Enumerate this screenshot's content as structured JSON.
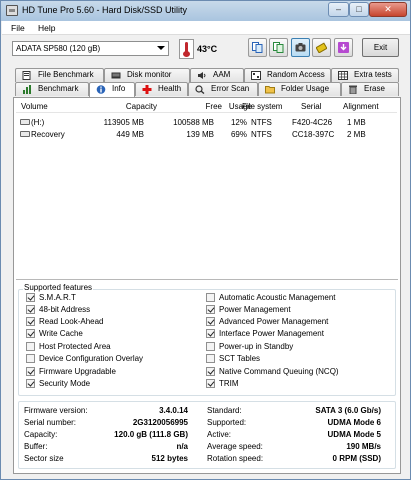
{
  "window": {
    "title": "HD Tune Pro 5.60 - Hard Disk/SSD Utility",
    "minimize": "–",
    "maximize": "□",
    "close": "✕"
  },
  "menu": [
    "File",
    "Help"
  ],
  "toolbar": {
    "drive": "ADATA SP580 (120 gB)",
    "temperature": "43°C",
    "exit_label": "Exit",
    "buttons": [
      "copy-icon",
      "copy-all-icon",
      "camera-icon",
      "options-icon",
      "download-icon"
    ]
  },
  "tabs_top": [
    "File Benchmark",
    "Disk monitor",
    "AAM",
    "Random Access",
    "Extra tests"
  ],
  "tabs_bottom": [
    "Benchmark",
    "Info",
    "Health",
    "Error Scan",
    "Folder Usage",
    "Erase"
  ],
  "active_tab": "Info",
  "volumes": {
    "headers": [
      "Volume",
      "Capacity",
      "Free",
      "Usage",
      "File system",
      "Serial",
      "Alignment"
    ],
    "rows": [
      {
        "volume": "(H:)",
        "capacity": "113905 MB",
        "free": "100588 MB",
        "usage": "12%",
        "fs": "NTFS",
        "serial": "F420-4C26",
        "alignment": "1 MB"
      },
      {
        "volume": "Recovery",
        "capacity": "449 MB",
        "free": "139 MB",
        "usage": "69%",
        "fs": "NTFS",
        "serial": "CC18-397C",
        "alignment": "2 MB"
      }
    ]
  },
  "features": {
    "legend": "Supported features",
    "left": [
      {
        "label": "S.M.A.R.T",
        "checked": true
      },
      {
        "label": "48-bit Address",
        "checked": true
      },
      {
        "label": "Read Look-Ahead",
        "checked": true
      },
      {
        "label": "Write Cache",
        "checked": true
      },
      {
        "label": "Host Protected Area",
        "checked": false
      },
      {
        "label": "Device Configuration Overlay",
        "checked": false
      },
      {
        "label": "Firmware Upgradable",
        "checked": true
      },
      {
        "label": "Security Mode",
        "checked": true
      }
    ],
    "right": [
      {
        "label": "Automatic Acoustic Management",
        "checked": false
      },
      {
        "label": "Power Management",
        "checked": true
      },
      {
        "label": "Advanced Power Management",
        "checked": true
      },
      {
        "label": "Interface Power Management",
        "checked": true
      },
      {
        "label": "Power-up in Standby",
        "checked": false
      },
      {
        "label": "SCT Tables",
        "checked": false
      },
      {
        "label": "Native Command Queuing (NCQ)",
        "checked": true
      },
      {
        "label": "TRIM",
        "checked": true
      }
    ]
  },
  "info": {
    "left": [
      {
        "label": "Firmware version:",
        "value": "3.4.0.14"
      },
      {
        "label": "Serial number:",
        "value": "2G3120056995"
      },
      {
        "label": "Capacity:",
        "value": "120.0 gB (111.8 GB)"
      },
      {
        "label": "Buffer:",
        "value": "n/a"
      },
      {
        "label": "Sector size",
        "value": "512 bytes"
      }
    ],
    "right": [
      {
        "label": "Standard:",
        "value": "SATA 3 (6.0 Gb/s)"
      },
      {
        "label": "Supported:",
        "value": "UDMA Mode 6"
      },
      {
        "label": "Active:",
        "value": "UDMA Mode 5"
      },
      {
        "label": "Average speed:",
        "value": "190 MB/s"
      },
      {
        "label": "Rotation speed:",
        "value": "0 RPM (SSD)"
      }
    ]
  }
}
